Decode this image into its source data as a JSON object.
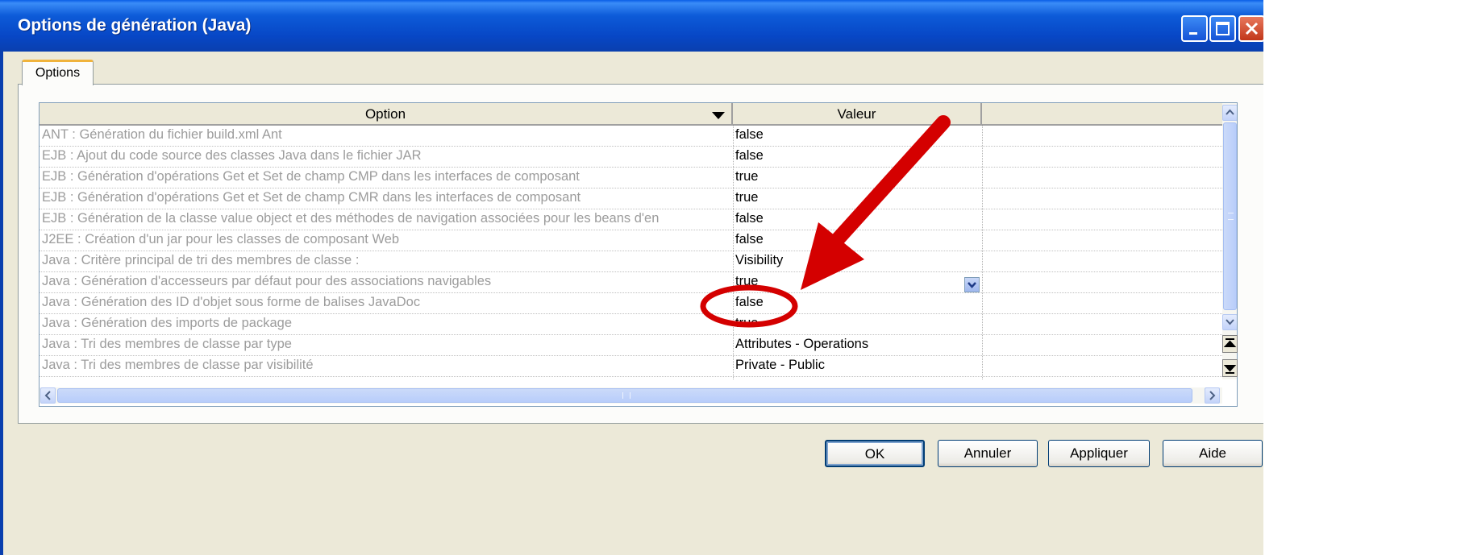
{
  "window": {
    "title": "Options de génération (Java)"
  },
  "tabs": [
    {
      "label": "Options"
    }
  ],
  "grid": {
    "columns": [
      {
        "label": "Option"
      },
      {
        "label": "Valeur"
      }
    ],
    "rows": [
      {
        "option": "ANT : Génération du fichier build.xml Ant",
        "value": "false"
      },
      {
        "option": "EJB : Ajout du code source des classes Java dans le fichier JAR",
        "value": "false"
      },
      {
        "option": "EJB : Génération d'opérations Get et Set de champ CMP dans les interfaces de composant",
        "value": "true"
      },
      {
        "option": "EJB : Génération d'opérations Get et Set de champ CMR dans les interfaces de composant",
        "value": "true"
      },
      {
        "option": "EJB : Génération de la classe value object et des méthodes de navigation associées pour les beans d'en",
        "value": "false"
      },
      {
        "option": "J2EE : Création d'un jar pour les classes de composant Web",
        "value": "false"
      },
      {
        "option": "Java : Critère principal de tri des membres de classe :",
        "value": "Visibility"
      },
      {
        "option": "Java : Génération d'accesseurs par défaut pour des associations navigables",
        "value": "true"
      },
      {
        "option": "Java : Génération des ID d'objet sous forme de balises JavaDoc",
        "value": "false"
      },
      {
        "option": "Java : Génération des imports de package",
        "value": "true"
      },
      {
        "option": "Java : Tri des membres de classe par type",
        "value": "Attributes - Operations"
      },
      {
        "option": "Java : Tri des membres de classe par visibilité",
        "value": "Private - Public"
      }
    ]
  },
  "buttons": {
    "ok": "OK",
    "cancel": "Annuler",
    "apply": "Appliquer",
    "help": "Aide"
  },
  "annotation": {
    "color": "#d40000"
  }
}
